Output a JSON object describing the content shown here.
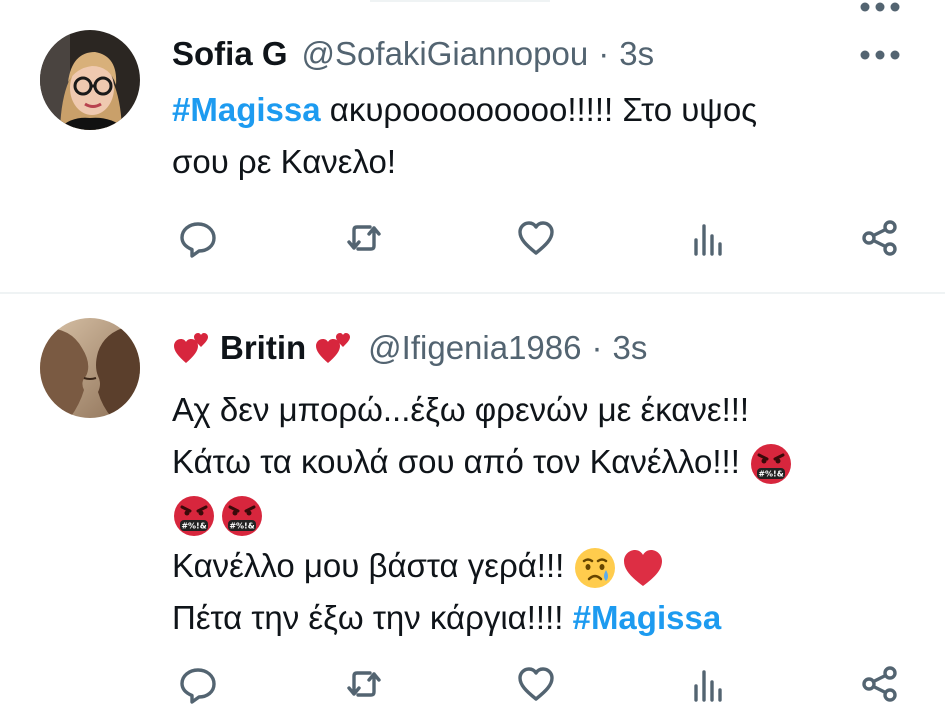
{
  "tweets": [
    {
      "name": "Sofia G",
      "handle": "@SofakiGiannopou",
      "dot": "·",
      "time": "3s",
      "avatar_icon": "woman-glasses-avatar",
      "lines": [
        {
          "hashtag": "#Magissa",
          "text": " ακυροοοοοοοοο!!!!! Στο υψος"
        },
        {
          "text": "σου ρε Κανελο!"
        }
      ]
    },
    {
      "name": "Britin",
      "name_emoji": "two-hearts",
      "handle": "@Ifigenia1986",
      "dot": "·",
      "time": "3s",
      "avatar_icon": "couple-kiss-avatar",
      "lines": [
        {
          "text": "Αχ δεν μπορώ...έξω φρενών με έκανε!!!"
        },
        {
          "text": "Κάτω τα κουλά σου από τον Κανέλλο!!! "
        },
        {
          "text": ""
        },
        {
          "text": "Κανέλλο μου βάστα γερά!!! "
        },
        {
          "text": "Πέτα την έξω την κάργια!!!! ",
          "hashtag": "#Magissa"
        }
      ],
      "emoji_symbol_text": "#%!&"
    }
  ],
  "actions": [
    "reply-icon",
    "retweet-icon",
    "like-icon",
    "views-icon",
    "share-icon"
  ],
  "colors": {
    "accent": "#1d9bf0",
    "secondary": "#536471",
    "text": "#0f1419",
    "heart": "#e0245e",
    "angry": "#d7263d"
  }
}
